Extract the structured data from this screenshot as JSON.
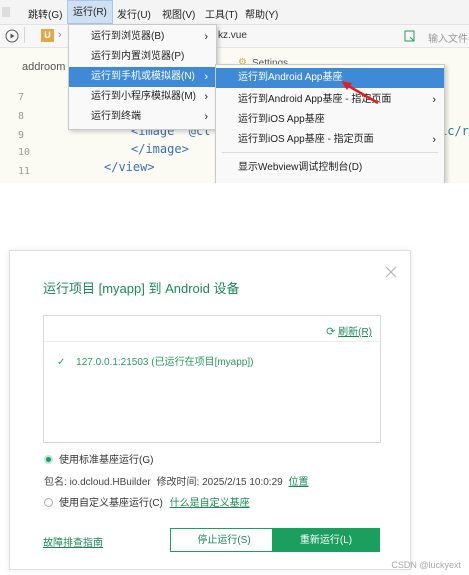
{
  "menubar": {
    "items": [
      {
        "label": "跳转(G)"
      },
      {
        "label": "运行(R)"
      },
      {
        "label": "发行(U)"
      },
      {
        "label": "视图(V)"
      },
      {
        "label": "工具(T)"
      },
      {
        "label": "帮助(Y)"
      }
    ]
  },
  "toolbar": {
    "search_placeholder": "输入文件名",
    "file_tab": "kz.vue"
  },
  "editor": {
    "breadcrumb_partial": "addroom",
    "settings_partial": "Settings",
    "line_numbers": [
      "7",
      "8",
      "9",
      "10",
      "11"
    ],
    "code_lines": [
      "<image  @cl",
      "</image>",
      "</view>"
    ],
    "code_right_fragment": "ic/r"
  },
  "run_menu": {
    "items": [
      {
        "label": "运行到浏览器(B)"
      },
      {
        "label": "运行到内置浏览器(P)"
      },
      {
        "label": "运行到手机或模拟器(N)"
      },
      {
        "label": "运行到小程序模拟器(M)"
      },
      {
        "label": "运行到终端"
      }
    ]
  },
  "device_menu": {
    "items": [
      {
        "label": "运行到Android App基座"
      },
      {
        "label": "运行到Android App基座 - 指定页面"
      },
      {
        "label": "运行到iOS App基座"
      },
      {
        "label": "运行到iOS App基座 - 指定页面"
      },
      {
        "label": "显示Webview调试控制台(D)"
      }
    ]
  },
  "dialog": {
    "title": "运行项目 [myapp] 到 Android 设备",
    "refresh_label": "刷新(R)",
    "device": "127.0.0.1:21503 (已运行在项目[myapp])",
    "radio_standard": "使用标准基座运行(G)",
    "package_prefix": "包名:",
    "package_name": "io.dcloud.HBuilder",
    "modified_prefix": "修改时间:",
    "modified_time": "2025/2/15 10:0:29",
    "location_link": "位置",
    "radio_custom": "使用自定义基座运行(C)",
    "custom_help_link": "什么是自定义基座",
    "troubleshoot_link": "故障排查指南",
    "stop_button": "停止运行(S)",
    "restart_button": "重新运行(L)"
  },
  "watermark": "CSDN @luckyext",
  "colors": {
    "accent": "#1b9f5f",
    "highlight": "#3f8ad6",
    "arrow": "#e02020"
  }
}
